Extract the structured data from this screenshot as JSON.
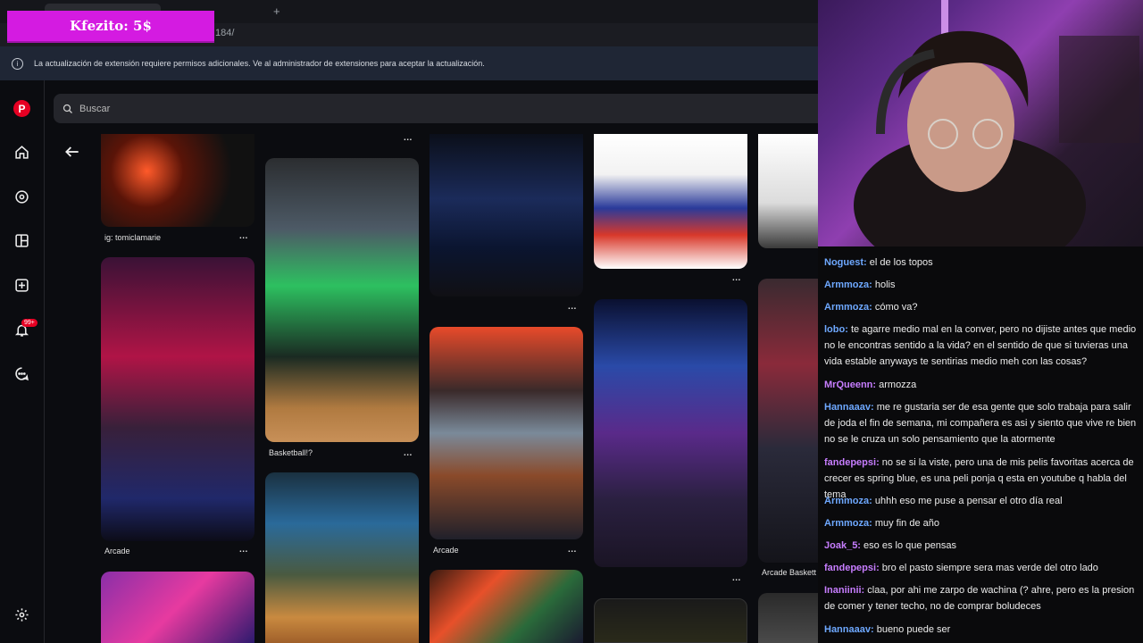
{
  "browser": {
    "url_fragment": "184/",
    "new_tab": "+"
  },
  "donation": {
    "text": "Kfezito: 5$"
  },
  "infobar": {
    "message": "La actualización de extensión requiere permisos adicionales. Ve al administrador de extensiones para aceptar la actualización."
  },
  "sidebar": {
    "notif_badge": "99+",
    "icons": [
      "pinterest-logo-icon",
      "home-icon",
      "explore-icon",
      "boards-icon",
      "create-icon",
      "notifications-icon",
      "messages-icon",
      "settings-icon"
    ]
  },
  "search": {
    "placeholder": "Buscar"
  },
  "pins": {
    "col1_caption1": "ig: tomiclamarie",
    "col1_caption2": "Arcade",
    "col2_caption1": "Basketball!?",
    "col3_caption1": "Arcade",
    "col5_caption1": "Arcade Baskett",
    "more": "..."
  },
  "chat": [
    {
      "user": "Noguest",
      "color": "#6ea8ff",
      "text": "el de los topos"
    },
    {
      "user": "Armmoza",
      "color": "#6ea8ff",
      "text": "holis"
    },
    {
      "user": "Armmoza",
      "color": "#6ea8ff",
      "text": "cómo va?"
    },
    {
      "user": "lobo",
      "color": "#6ea8ff",
      "text": "te agarre medio mal en la conver, pero no dijiste antes que medio no le encontras sentido a la vida? en el sentido de que si tuvieras una vida estable anyways te sentirias medio meh con las cosas?"
    },
    {
      "user": "MrQueenn",
      "color": "#c77dff",
      "text": "armozza"
    },
    {
      "user": "Hannaaav",
      "color": "#6ea8ff",
      "text": "me re gustaria ser de esa gente que solo trabaja para salir de joda el fin de semana, mi compañera es asi y siento que vive re bien no se le cruza un solo pensamiento que la atormente"
    },
    {
      "user": "fandepepsi",
      "color": "#c77dff",
      "text": "no se si la viste, pero una de mis pelis favoritas acerca de crecer es spring blue, es una peli ponja q esta en youtube q habla del tema"
    },
    {
      "user": "Armmoza",
      "color": "#6ea8ff",
      "text": "uhhh eso me puse a pensar el otro día real"
    },
    {
      "user": "Armmoza",
      "color": "#6ea8ff",
      "text": "muy fin de año"
    },
    {
      "user": "Joak_5",
      "color": "#c77dff",
      "text": "eso es lo que pensas"
    },
    {
      "user": "fandepepsi",
      "color": "#c77dff",
      "text": "bro el pasto siempre sera mas verde del otro lado"
    },
    {
      "user": "Inaniinii",
      "color": "#c77dff",
      "text": "claa, por ahi me zarpo de wachina (? ahre, pero es la presion de comer y tener techo, no de comprar boludeces"
    },
    {
      "user": "Hannaaav",
      "color": "#6ea8ff",
      "text": "bueno puede ser"
    }
  ]
}
